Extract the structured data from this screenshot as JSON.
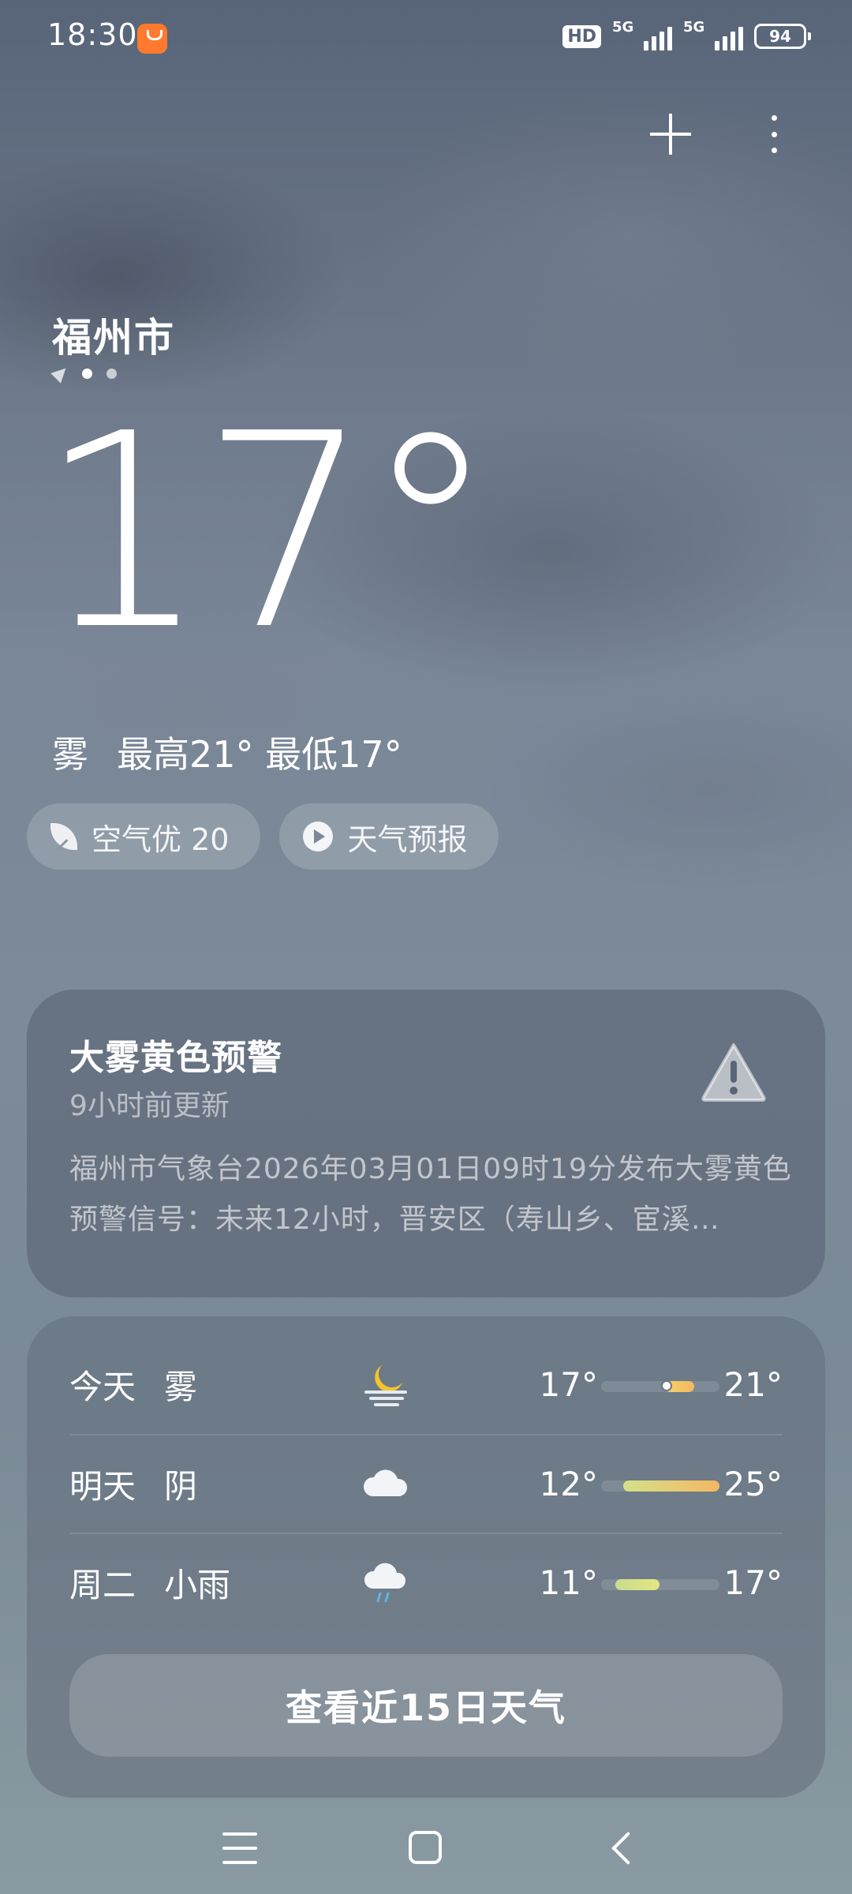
{
  "status_bar": {
    "time": "18:30",
    "hd_label": "HD",
    "signal_1_label": "5G",
    "signal_2_label": "5G",
    "battery": "94"
  },
  "location": {
    "city": "福州市"
  },
  "current": {
    "temperature": "17°",
    "condition": "雾",
    "high_low": "最高21° 最低17°"
  },
  "chips": {
    "air_quality": "空气优 20",
    "forecast_video": "天气预报"
  },
  "warning": {
    "title": "大雾黄色预警",
    "updated": "9小时前更新",
    "body": "福州市气象台2026年03月01日09时19分发布大雾黄色预警信号：未来12小时，晋安区（寿山乡、宦溪…"
  },
  "forecast": {
    "days": [
      {
        "day": "今天",
        "condition": "雾",
        "icon": "moon-fog-icon",
        "low": "17°",
        "high": "21°"
      },
      {
        "day": "明天",
        "condition": "阴",
        "icon": "cloud-icon",
        "low": "12°",
        "high": "25°"
      },
      {
        "day": "周二",
        "condition": "小雨",
        "icon": "light-rain-icon",
        "low": "11°",
        "high": "17°"
      }
    ],
    "view_more_label": "查看近15日天气"
  },
  "colors": {
    "warning_accent": "#f0c040",
    "bar_warm": "#f4b860",
    "bar_mild": "#d6e08a"
  }
}
